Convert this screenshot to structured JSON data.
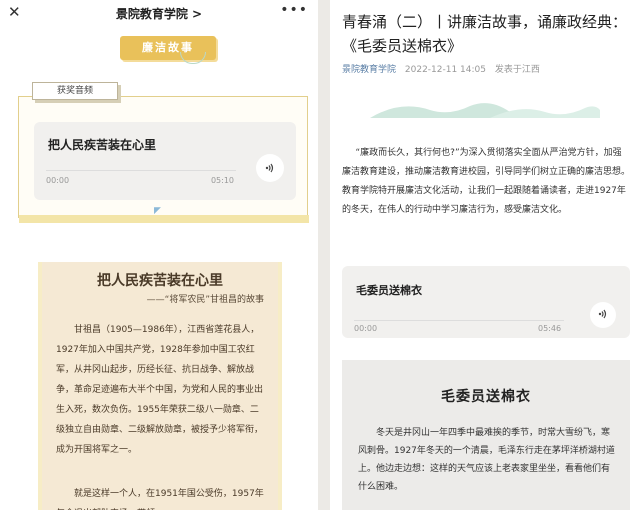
{
  "left": {
    "nav": {
      "close": "✕",
      "title": "景院教育学院 >",
      "more": "•••"
    },
    "badge": "廉洁故事",
    "audio_tab": "获奖音频",
    "audio": {
      "title": "把人民疾苦装在心里",
      "start": "00:00",
      "end": "05:10"
    },
    "article": {
      "heading": "把人民疾苦装在心里",
      "subheading": "——“将军农民”甘祖昌的故事",
      "para1": "甘祖昌（1905—1986年），江西省莲花县人，1927年加入中国共产党，1928年参加中国工农红军，从井冈山起步，历经长征、抗日战争、解放战争，革命足迹遍布大半个中国，为党和人民的事业出生入死，数次负伤。1955年荣获二级八一勋章、二级独立自由勋章、二级解放勋章，被授予少将军衔，成为开国将军之一。",
      "para2": "就是这样一个人，在1951年国公受伤，1957年年令退出部队实场，带领"
    }
  },
  "right": {
    "title": "青春涌（二）丨讲廉洁故事，诵廉政经典：《毛委员送棉衣》",
    "meta": {
      "source": "景院教育学院",
      "date": "2022-12-11 14:05",
      "location": "发表于江西"
    },
    "intro": "“廉政而长久，其行何也?”为深入贯彻落实全面从严治党方针，加强廉洁教育建设，推动廉洁教育进校园，引导同学们树立正确的廉洁思想。教育学院特开展廉洁文化活动，让我们一起跟随着诵读者，走进1927年的冬天，在伟人的行动中学习廉洁行为，感受廉洁文化。",
    "audio": {
      "title": "毛委员送棉衣",
      "start": "00:00",
      "end": "05:46"
    },
    "card": {
      "heading": "毛委员送棉衣",
      "body": "冬天是井冈山一年四季中最难挨的季节，时常大雪纷飞，寒风刺骨。1927年冬天的一个清晨，毛泽东行走在茅坪洋桥湖村道上。他边走边想：这样的天气应该上老表家里坐坐，看看他们有什么困难。"
    }
  },
  "colors": {
    "badge": "#e9c15a",
    "accent_link": "#5b7fa6",
    "article_bg": "#f5e9d4"
  }
}
